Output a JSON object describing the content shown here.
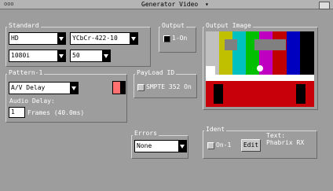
{
  "titlebar": {
    "left": "ooo",
    "title": "Generator Video"
  },
  "standard": {
    "title": "Standard",
    "format": "HD",
    "sampling": "YCbCr-422-10",
    "lines": "1080i",
    "rate": "50"
  },
  "output": {
    "title": "Output",
    "label": "1-On",
    "checked": true
  },
  "output_image": {
    "title": "Output Image"
  },
  "pattern": {
    "title": "Pattern-1",
    "value": "A/V Delay",
    "color": "#ff7070",
    "audio_delay_label": "Audio Delay:",
    "audio_delay_value": "1",
    "frames_label": "Frames (40.0ms)"
  },
  "payload": {
    "title": "PayLoad ID",
    "label": "SMPTE 352 On"
  },
  "errors": {
    "title": "Errors",
    "value": "None"
  },
  "ident": {
    "title": "Ident",
    "on_label": "On-1",
    "edit_label": "Edit",
    "text_label": "Text:",
    "text_value": "Phabrix RX"
  }
}
